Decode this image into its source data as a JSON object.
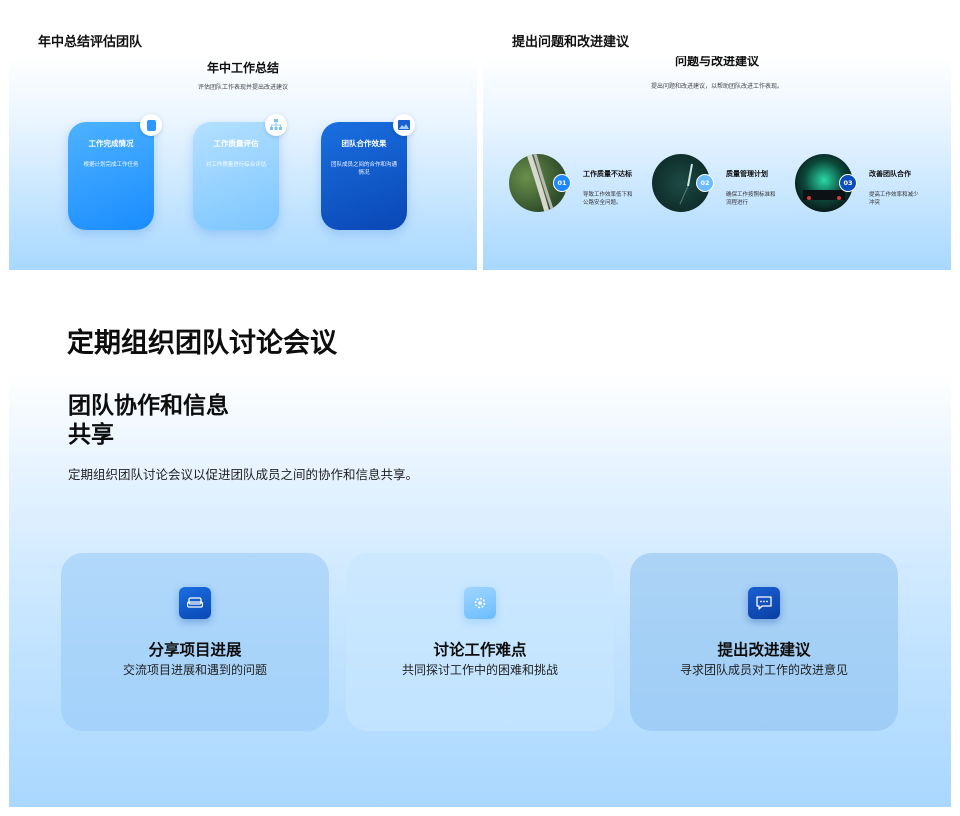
{
  "slide1": {
    "caption": "年中总结评估团队",
    "title": "年中工作总结",
    "subtitle": "评估团队工作表现并提出改进建议",
    "cards": [
      {
        "title": "工作完成情况",
        "desc": "根据计划完成工作任务",
        "icon": "document-icon"
      },
      {
        "title": "工作质量评估",
        "desc": "对工作质量进行综合评估",
        "icon": "org-chart-icon"
      },
      {
        "title": "团队合作效果",
        "desc": "团队成员之间的合作和沟通情况",
        "icon": "image-icon"
      }
    ]
  },
  "slide2": {
    "caption": "提出问题和改进建议",
    "title": "问题与改进建议",
    "subtitle": "提出问题和改进建议，以帮助团队改进工作表现。",
    "items": [
      {
        "num": "01",
        "title": "工作质量不达标",
        "desc": "导致工作效率低下和公路安全问题。"
      },
      {
        "num": "02",
        "title": "质量管理计划",
        "desc": "确保工作按照标准和流程进行"
      },
      {
        "num": "03",
        "title": "改善团队合作",
        "desc": "提高工作效率和减少冲突"
      }
    ]
  },
  "slide3": {
    "title": "定期组织团队讨论会议",
    "heading_line1": "团队协作和信息",
    "heading_line2": "共享",
    "description": "定期组织团队讨论会议以促进团队成员之间的协作和信息共享。",
    "cards": [
      {
        "title": "分享项目进展",
        "desc": "交流项目进展和遇到的问题",
        "icon": "sofa-icon"
      },
      {
        "title": "讨论工作难点",
        "desc": "共同探讨工作中的困难和挑战",
        "icon": "gear-icon"
      },
      {
        "title": "提出改进建议",
        "desc": "寻求团队成员对工作的改进意见",
        "icon": "chat-icon"
      }
    ]
  },
  "colors": {
    "accent": "#1e88ff",
    "dark_blue": "#0b4fbf",
    "light_blue": "#8fd0ff"
  }
}
